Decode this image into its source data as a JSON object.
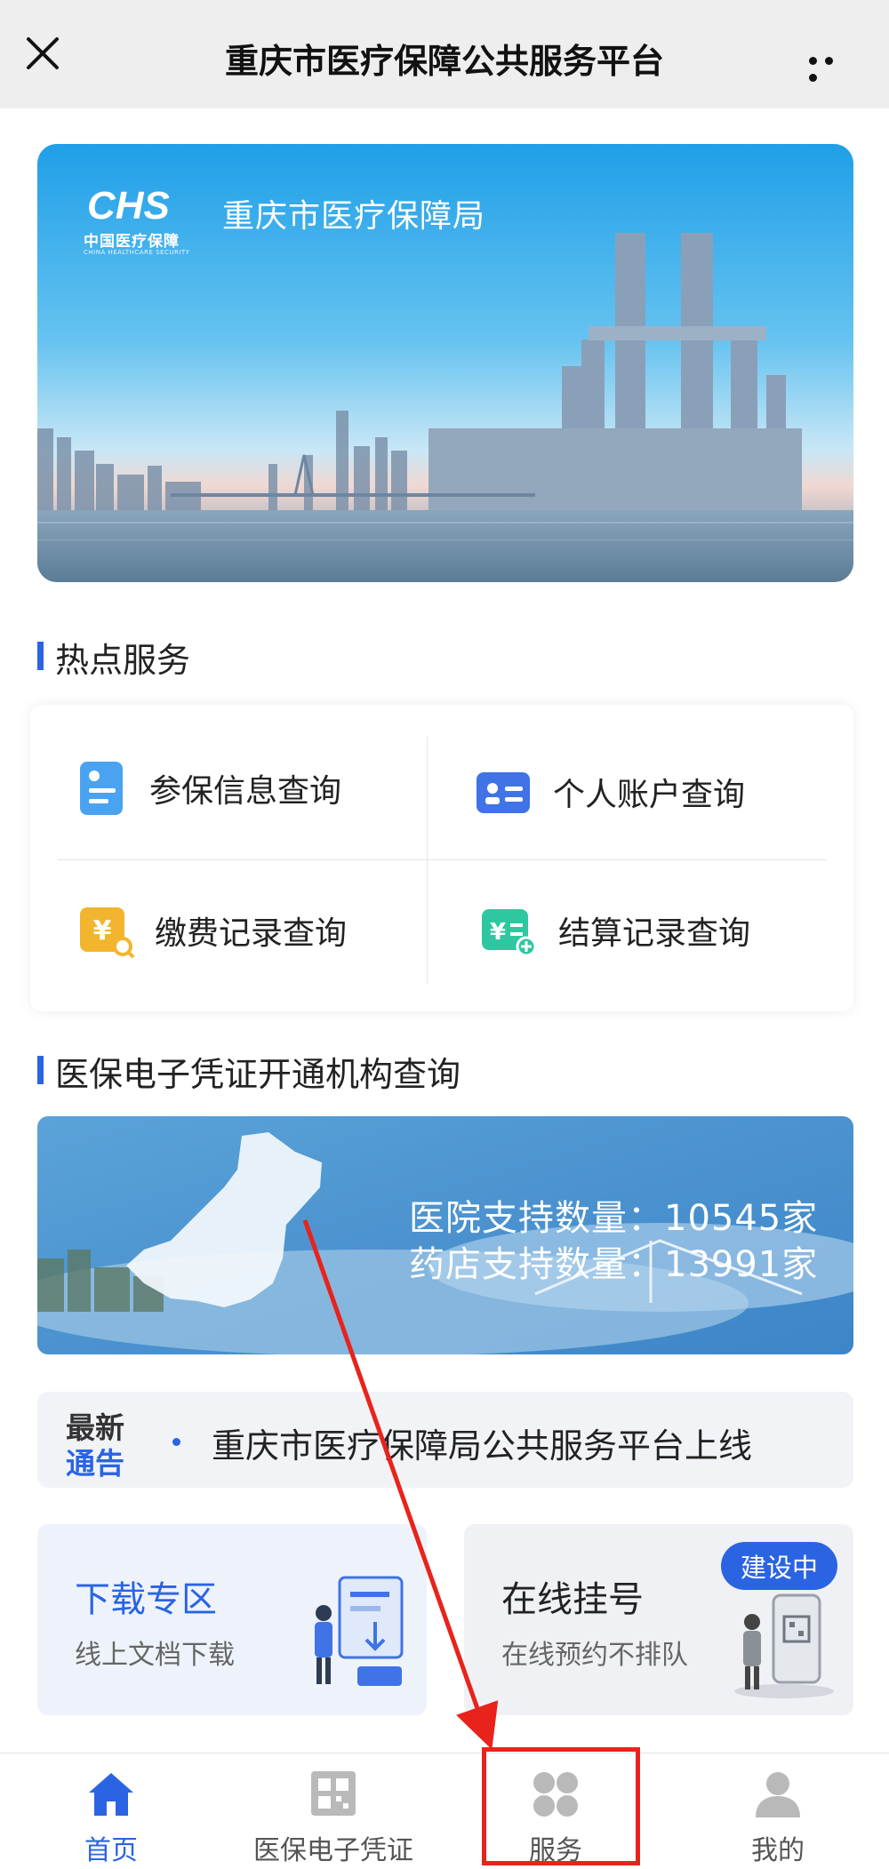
{
  "header": {
    "title": "重庆市医疗保障公共服务平台",
    "close_icon": "close-icon",
    "more_icon": "more-dots-icon"
  },
  "banner": {
    "logo_text": "CHS",
    "logo_cn": "中国医疗保障",
    "logo_en": "CHINA HEALTHCARE SECURITY",
    "agency": "重庆市医疗保障局"
  },
  "hot_services": {
    "title": "热点服务",
    "items": [
      {
        "label": "参保信息查询",
        "icon": "insured-info-icon",
        "color": "#4aa3f0"
      },
      {
        "label": "个人账户查询",
        "icon": "personal-account-icon",
        "color": "#3f73e6"
      },
      {
        "label": "缴费记录查询",
        "icon": "payment-record-icon",
        "color": "#f3b52e"
      },
      {
        "label": "结算记录查询",
        "icon": "settlement-record-icon",
        "color": "#2fc7a0"
      }
    ]
  },
  "ecert": {
    "title": "医保电子凭证开通机构查询",
    "hospital_stat": "医院支持数量：10545家",
    "pharmacy_stat": "药店支持数量：13991家"
  },
  "notice": {
    "tag_line1": "最新",
    "tag_line2": "通告",
    "text": "重庆市医疗保障局公共服务平台上线"
  },
  "features": {
    "download": {
      "title": "下载专区",
      "subtitle": "线上文档下载"
    },
    "booking": {
      "title": "在线挂号",
      "subtitle": "在线预约不排队",
      "badge": "建设中"
    }
  },
  "bottom_nav": {
    "items": [
      {
        "label": "首页",
        "icon": "home-icon",
        "active": true
      },
      {
        "label": "医保电子凭证",
        "icon": "qr-code-icon",
        "active": false
      },
      {
        "label": "服务",
        "icon": "services-grid-icon",
        "active": false
      },
      {
        "label": "我的",
        "icon": "user-icon",
        "active": false
      }
    ]
  },
  "colors": {
    "accent": "#2b64e3",
    "annotation_red": "#e8231c"
  }
}
